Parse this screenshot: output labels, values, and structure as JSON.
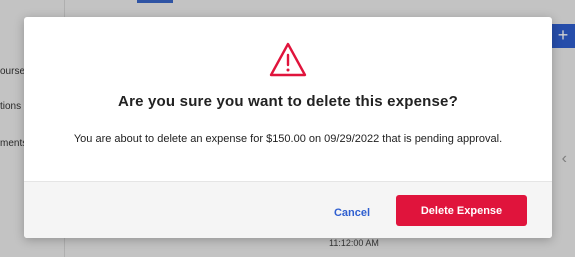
{
  "background": {
    "sidebar_labels": [
      "oursen",
      "tions",
      "ments"
    ],
    "add_button_glyph": "+",
    "chevron_glyph": "‹",
    "timestamp": "11:12:00 AM"
  },
  "dialog": {
    "icon": "warning-triangle-icon",
    "title": "Are you sure you want to delete this expense?",
    "message": "You are about to delete an expense for $150.00 on 09/29/2022 that is pending approval.",
    "cancel_label": "Cancel",
    "confirm_label": "Delete Expense"
  },
  "colors": {
    "danger": "#e0143c",
    "link": "#2f5fd0"
  }
}
